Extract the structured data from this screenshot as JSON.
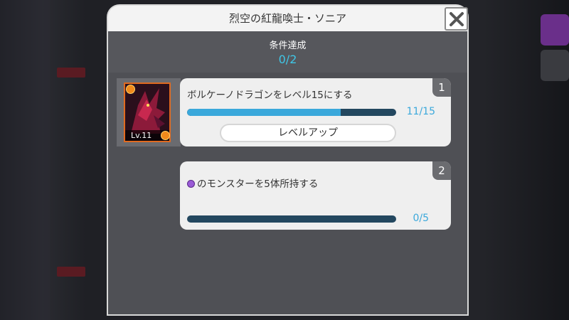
{
  "modal": {
    "title": "烈空の紅龍喚士・ソニア",
    "condition_label": "条件達成",
    "condition_progress": "0/2"
  },
  "monster": {
    "level_label": "Lv.11"
  },
  "missions": [
    {
      "number": "1",
      "text": "ボルケーノドラゴンをレベル15にする",
      "progress_text": "11/15",
      "progress_fraction": 0.733,
      "button_label": "レベルアップ"
    },
    {
      "number": "2",
      "text": "のモンスターを5体所持する",
      "orb_icon": "purple-orb-icon",
      "progress_text": "0/5",
      "progress_fraction": 0.0
    }
  ],
  "colors": {
    "accent": "#3aa8db",
    "condition_count": "#3fc6e6",
    "bar_track": "#23475f"
  }
}
